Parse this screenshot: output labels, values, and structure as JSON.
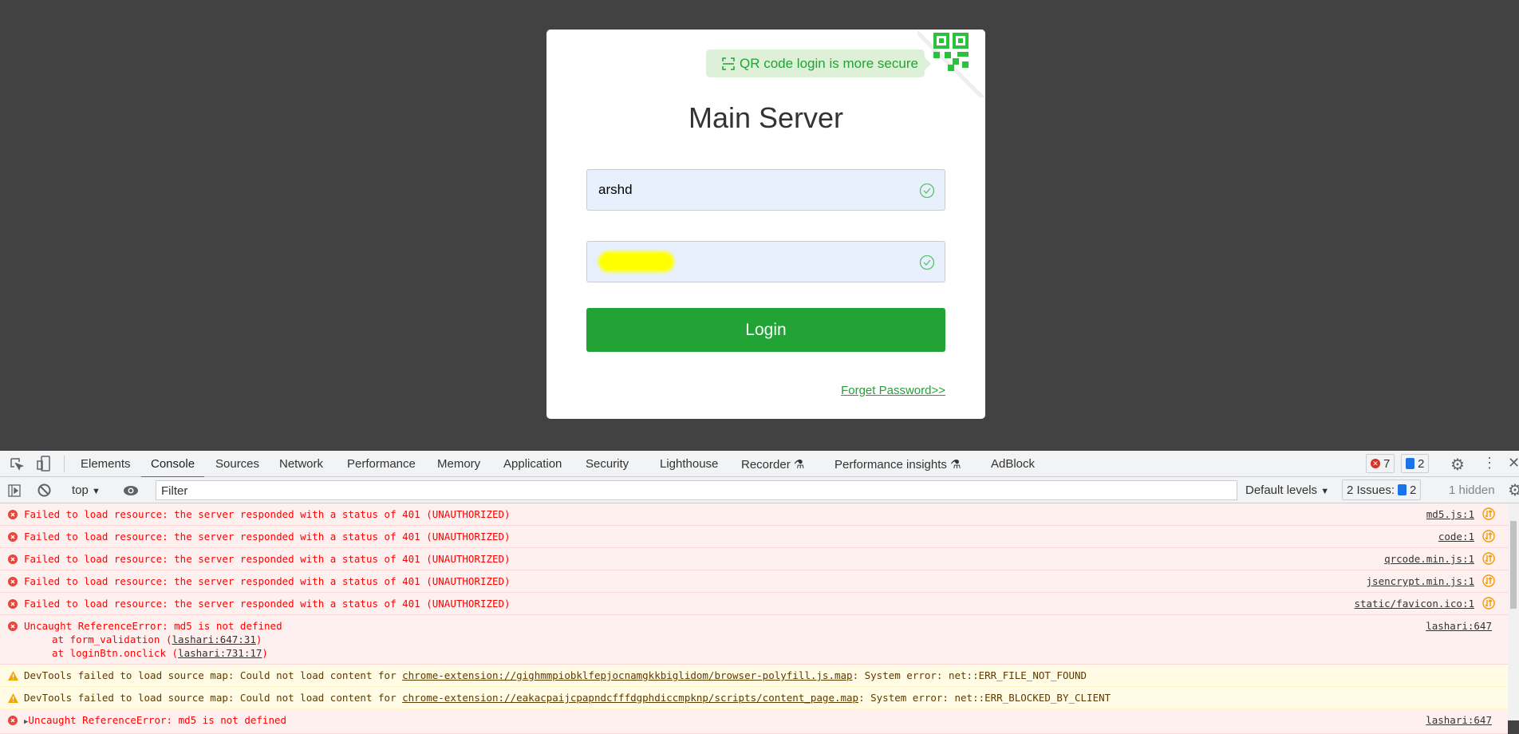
{
  "login": {
    "qr_tip": "QR code login is more secure",
    "title": "Main Server",
    "username": "arshd",
    "login_label": "Login",
    "forgot_label": "Forget Password>>"
  },
  "devtools": {
    "tabs": [
      "Elements",
      "Console",
      "Sources",
      "Network",
      "Performance",
      "Memory",
      "Application",
      "Security",
      "Lighthouse",
      "Recorder",
      "Performance insights",
      "AdBlock"
    ],
    "error_count": "7",
    "message_count": "2",
    "context": "top",
    "filter_placeholder": "Filter",
    "levels": "Default levels",
    "issues_label": "2 Issues:",
    "issues_count": "2",
    "hidden": "1 hidden",
    "messages": [
      {
        "text": "Failed to load resource: the server responded with a status of 401 (UNAUTHORIZED)",
        "source": "md5.js:1"
      },
      {
        "text": "Failed to load resource: the server responded with a status of 401 (UNAUTHORIZED)",
        "source": "code:1"
      },
      {
        "text": "Failed to load resource: the server responded with a status of 401 (UNAUTHORIZED)",
        "source": "qrcode.min.js:1"
      },
      {
        "text": "Failed to load resource: the server responded with a status of 401 (UNAUTHORIZED)",
        "source": "jsencrypt.min.js:1"
      },
      {
        "text": "Failed to load resource: the server responded with a status of 401 (UNAUTHORIZED)",
        "source": "static/favicon.ico:1"
      }
    ],
    "ref_error": {
      "text": "Uncaught ReferenceError: md5 is not defined",
      "at1": "at form_validation (",
      "link1": "lashari:647:31",
      "at2": "at loginBtn.onclick (",
      "link2": "lashari:731:17",
      "close": ")",
      "source": "lashari:647"
    },
    "warnings": [
      {
        "prefix": "DevTools failed to load source map: Could not load content for ",
        "url": "chrome-extension://gighmmpiobklfepjocnamgkkbiglidom/browser-polyfill.js.map",
        "suffix": ": System error: net::ERR_FILE_NOT_FOUND"
      },
      {
        "prefix": "DevTools failed to load source map: Could not load content for ",
        "url": "chrome-extension://eakacpaijcpapndcfffdgphdiccmpknp/scripts/content_page.map",
        "suffix": ": System error: net::ERR_BLOCKED_BY_CLIENT"
      }
    ],
    "last_error": {
      "text": "Uncaught ReferenceError: md5 is not defined",
      "source": "lashari:647"
    }
  }
}
